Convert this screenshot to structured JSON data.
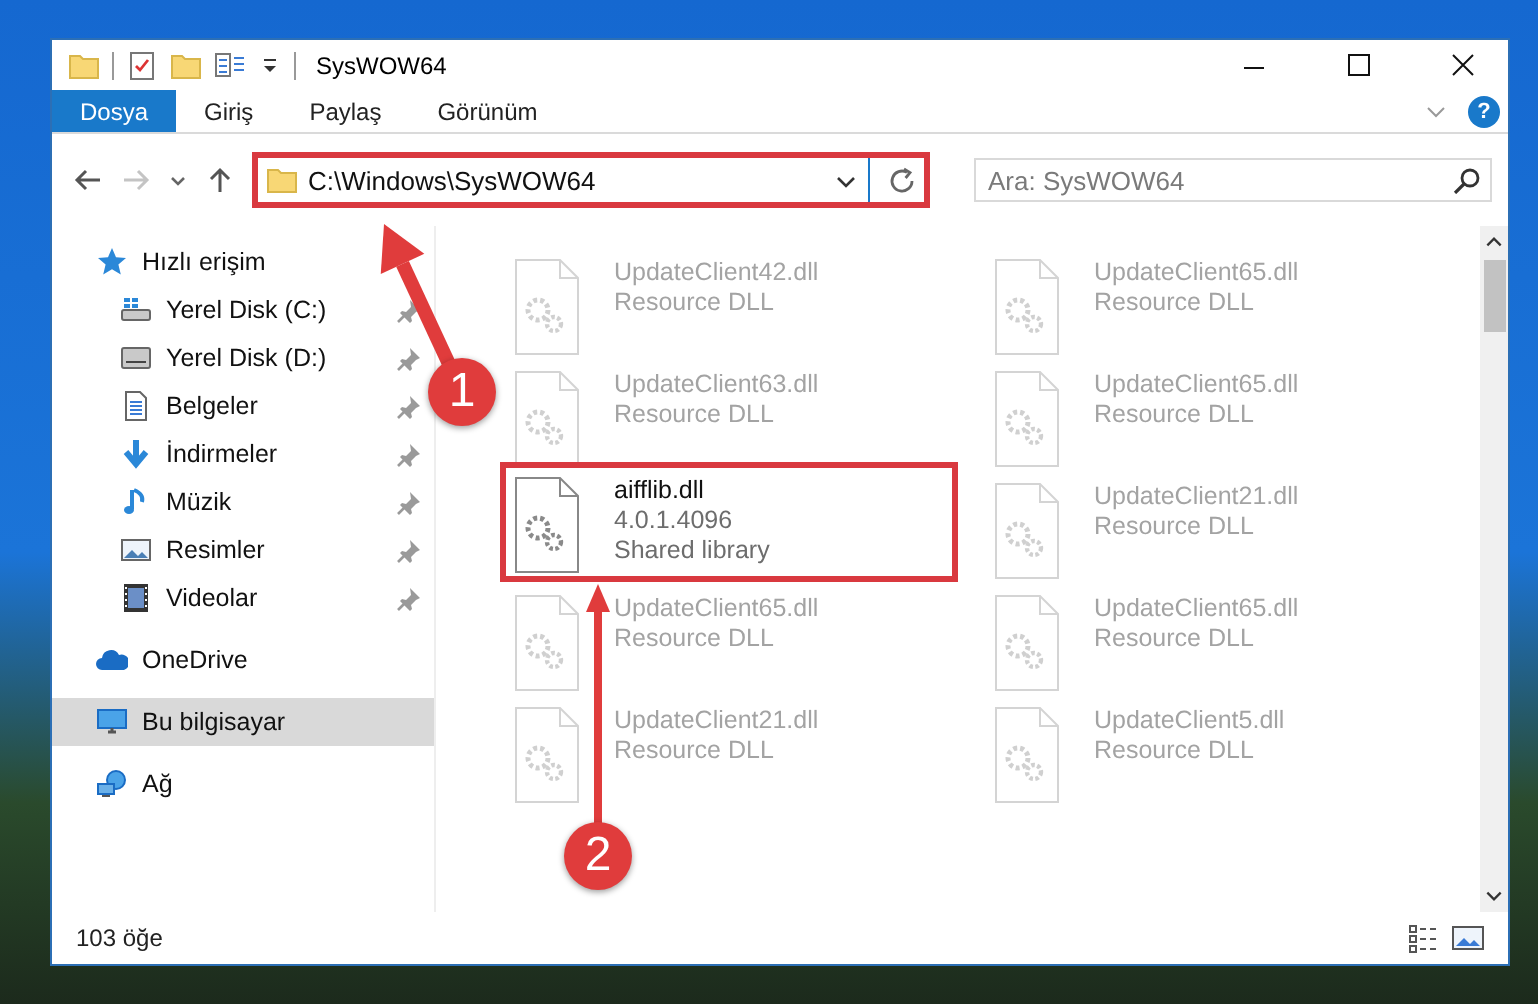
{
  "window": {
    "title": "SysWOW64"
  },
  "ribbon": {
    "tabs": [
      {
        "label": "Dosya",
        "selected": true
      },
      {
        "label": "Giriş",
        "selected": false
      },
      {
        "label": "Paylaş",
        "selected": false
      },
      {
        "label": "Görünüm",
        "selected": false
      }
    ],
    "help": "?"
  },
  "address": {
    "path": "C:\\Windows\\SysWOW64",
    "highlighted": true
  },
  "search": {
    "placeholder": "Ara: SysWOW64"
  },
  "sidebar": {
    "items": [
      {
        "label": "Hızlı erişim",
        "kind": "star",
        "selected": false,
        "children": [
          {
            "label": "Yerel Disk (C:)",
            "kind": "drive-system",
            "selected": false,
            "pinned": true
          },
          {
            "label": "Yerel Disk (D:)",
            "kind": "drive",
            "selected": false,
            "pinned": true
          },
          {
            "label": "Belgeler",
            "kind": "document",
            "selected": false,
            "pinned": true
          },
          {
            "label": "İndirmeler",
            "kind": "download",
            "selected": false,
            "pinned": true
          },
          {
            "label": "Müzik",
            "kind": "music",
            "selected": false,
            "pinned": true
          },
          {
            "label": "Resimler",
            "kind": "picture",
            "selected": false,
            "pinned": true
          },
          {
            "label": "Videolar",
            "kind": "video",
            "selected": false,
            "pinned": true
          }
        ]
      },
      {
        "label": "OneDrive",
        "kind": "cloud",
        "selected": false
      },
      {
        "label": "Bu bilgisayar",
        "kind": "computer",
        "selected": true
      },
      {
        "label": "Ağ",
        "kind": "network",
        "selected": false
      }
    ]
  },
  "files": [
    {
      "name": "UpdateClient42.dll",
      "description": "Resource DLL",
      "blurred": true,
      "highlighted": false
    },
    {
      "name": "UpdateClient65.dll",
      "description": "Resource DLL",
      "blurred": true,
      "highlighted": false
    },
    {
      "name": "UpdateClient63.dll",
      "description": "Resource DLL",
      "blurred": true,
      "highlighted": false
    },
    {
      "name": "UpdateClient65.dll",
      "description": "Resource DLL",
      "blurred": true,
      "highlighted": false
    },
    {
      "name": "aifflib.dll",
      "version": "4.0.1.4096",
      "description": "Shared library",
      "blurred": false,
      "highlighted": true
    },
    {
      "name": "UpdateClient21.dll",
      "description": "Resource DLL",
      "blurred": true,
      "highlighted": false
    },
    {
      "name": "UpdateClient65.dll",
      "description": "Resource DLL",
      "blurred": true,
      "highlighted": false
    },
    {
      "name": "UpdateClient65.dll",
      "description": "Resource DLL",
      "blurred": true,
      "highlighted": false
    },
    {
      "name": "UpdateClient21.dll",
      "description": "Resource DLL",
      "blurred": true,
      "highlighted": false
    },
    {
      "name": "UpdateClient5.dll",
      "description": "Resource DLL",
      "blurred": true,
      "highlighted": false
    }
  ],
  "annotations": [
    {
      "number": "1"
    },
    {
      "number": "2"
    }
  ],
  "status_bar": {
    "item_count": "103 öğe"
  }
}
